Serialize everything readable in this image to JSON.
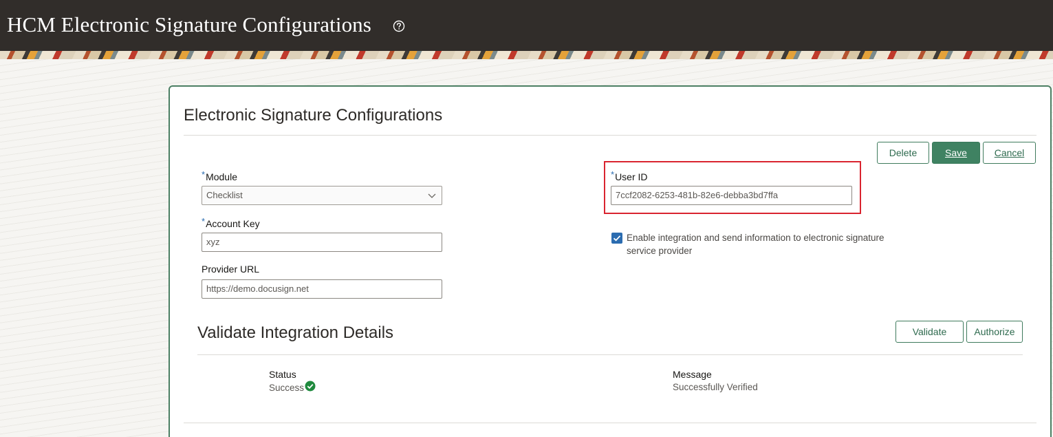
{
  "header": {
    "title": "HCM Electronic Signature Configurations",
    "help_icon": "help-circle-icon"
  },
  "card": {
    "title": "Electronic Signature Configurations",
    "buttons": {
      "delete": "Delete",
      "save": "Save",
      "cancel": "Cancel"
    },
    "fields": {
      "module": {
        "label": "Module",
        "required": "*",
        "value": "Checklist",
        "icon": "chevron-down-icon"
      },
      "account_key": {
        "label": "Account Key",
        "required": "*",
        "value": "xyz"
      },
      "provider_url": {
        "label": "Provider URL",
        "value": "https://demo.docusign.net"
      },
      "user_id": {
        "label": "User ID",
        "required": "*",
        "value": "7ccf2082-6253-481b-82e6-debba3bd7ffa"
      }
    },
    "enable_integration": {
      "checked": true,
      "label": "Enable integration and send information to electronic signature service provider"
    }
  },
  "validate_section": {
    "title": "Validate Integration Details",
    "buttons": {
      "validate": "Validate",
      "authorize": "Authorize"
    },
    "status": {
      "label": "Status",
      "value": "Success",
      "icon": "check-circle-icon"
    },
    "message": {
      "label": "Message",
      "value": "Successfully Verified"
    }
  },
  "colors": {
    "header_bg": "#312d2a",
    "card_border": "#4b7f63",
    "primary_button": "#3f8262",
    "highlight": "#d9232f",
    "required_marker": "#2a6cb0",
    "success": "#1f8a3e"
  }
}
